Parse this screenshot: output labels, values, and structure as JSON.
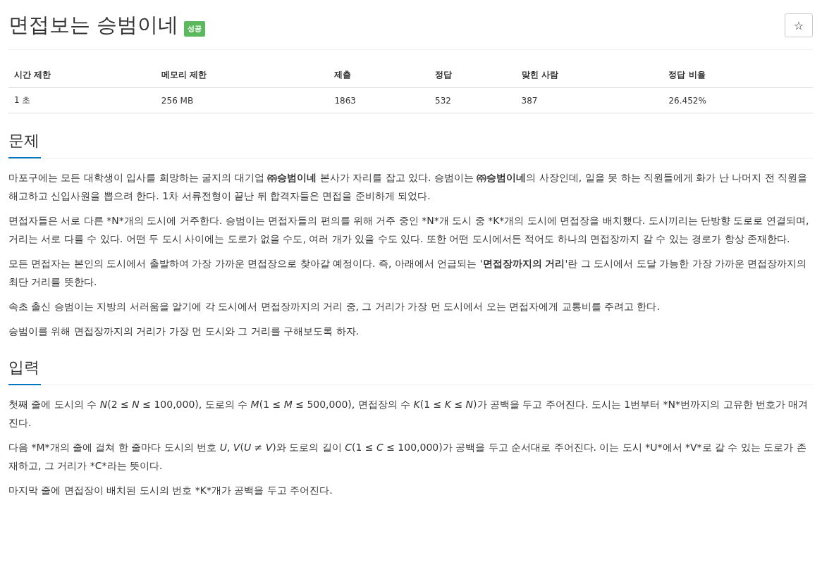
{
  "title": "면접보는 승범이네",
  "badge": "성공",
  "star_button": "☆",
  "stats": {
    "columns": [
      "시간 제한",
      "메모리 제한",
      "제출",
      "정답",
      "맞힌 사람",
      "정답 비율"
    ],
    "row": [
      "1 초",
      "256 MB",
      "1863",
      "532",
      "387",
      "26.452%"
    ]
  },
  "sections": [
    {
      "heading": "문제",
      "paragraphs": [
        "마포구에는 모든 대학생이 입사를 희망하는 굴지의 대기업 **㈜승범이네** 본사가 자리를 잡고 있다. 승범이는 **㈜승범이네**의 사장인데, 일을 못 하는 직원들에게 화가 난 나머지 전 직원을 해고하고 신입사원을 뽑으려 한다. 1차 서류전형이 끝난 뒤 합격자들은 면접을 준비하게 되었다.",
        "면접자들은 서로 다른 *N*개의 도시에 거주한다. 승범이는 면접자들의 편의를 위해 거주 중인 *N*개 도시 중 *K*개의 도시에 면접장을 배치했다. 도시끼리는 단방향 도로로 연결되며, 거리는 서로 다를 수 있다. 어떤 두 도시 사이에는 도로가 없을 수도, 여러 개가 있을 수도 있다. 또한 어떤 도시에서든 적어도 하나의 면접장까지 갈 수 있는 경로가 항상 존재한다.",
        "모든 면접자는 본인의 도시에서 출발하여 가장 가까운 면접장으로 찾아갈 예정이다. 즉, 아래에서 언급되는 '**면접장까지의 거리**'란 그 도시에서 도달 가능한 가장 가까운 면접장까지의 최단 거리를 뜻한다.",
        "속초 출신 승범이는 지방의 서러움을 알기에 각 도시에서 면접장까지의 거리 중, 그 거리가 가장 먼 도시에서 오는 면접자에게 교통비를 주려고 한다.",
        "승범이를 위해 면접장까지의 거리가 가장 먼 도시와 그 거리를 구해보도록 하자."
      ]
    },
    {
      "heading": "입력",
      "paragraphs": [
        "첫째 줄에 도시의 수 *N*(2 ≤ *N* ≤ 100,000), 도로의 수 *M*(1 ≤ *M* ≤ 500,000), 면접장의 수 *K*(1 ≤ *K* ≤ *N*)가 공백을 두고 주어진다. 도시는 1번부터 *N*번까지의 고유한 번호가 매겨진다.",
        "다음 *M*개의 줄에 걸쳐 한 줄마다 도시의 번호 *U*, *V*(*U* ≠ *V*)와 도로의 길이 *C*(1 ≤ *C* ≤ 100,000)가 공백을 두고 순서대로 주어진다. 이는 도시 *U*에서 *V*로 갈 수 있는 도로가 존재하고, 그 거리가 *C*라는 뜻이다.",
        "마지막 줄에 면접장이 배치된 도시의 번호 *K*개가 공백을 두고 주어진다."
      ]
    }
  ]
}
